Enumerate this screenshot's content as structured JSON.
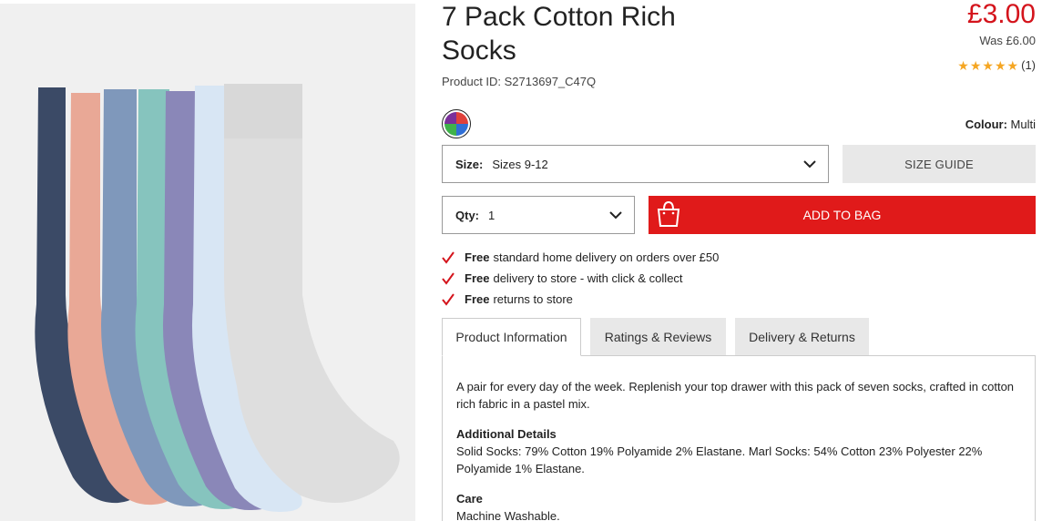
{
  "product": {
    "title": "7 Pack Cotton Rich Socks",
    "product_id": "Product ID: S2713697_C47Q",
    "price": "£3.00",
    "was_price": "Was £6.00",
    "rating_stars": 5,
    "rating_count": "(1)",
    "image_icon": "socks-product-image"
  },
  "colour": {
    "label": "Colour:",
    "value": "Multi",
    "swatch_icon": "multi-colour-swatch-icon"
  },
  "size": {
    "label": "Size:",
    "value": "Sizes 9-12"
  },
  "size_guide": "SIZE GUIDE",
  "qty": {
    "label": "Qty:",
    "value": "1"
  },
  "add_to_bag": "ADD TO BAG",
  "benefits": [
    {
      "bold": "Free",
      "text": "standard home delivery on orders over £50"
    },
    {
      "bold": "Free",
      "text": "delivery to store - with click & collect"
    },
    {
      "bold": "Free",
      "text": "returns to store"
    }
  ],
  "tabs": [
    {
      "label": "Product Information",
      "active": true
    },
    {
      "label": "Ratings & Reviews",
      "active": false
    },
    {
      "label": "Delivery & Returns",
      "active": false
    }
  ],
  "product_info": {
    "description": "A pair for every day of the week. Replenish your top drawer with this pack of seven socks, crafted in cotton rich fabric in a pastel mix.",
    "additional_title": "Additional Details",
    "additional_text": "Solid Socks: 79% Cotton 19% Polyamide 2% Elastane. Marl Socks: 54% Cotton 23% Polyester 22% Polyamide 1% Elastane.",
    "care_title": "Care",
    "care_text": "Machine Washable."
  },
  "colors": {
    "price_red": "#d4141c",
    "button_red": "#e01a1a",
    "star": "#f5a623",
    "check_red": "#d4141c"
  }
}
